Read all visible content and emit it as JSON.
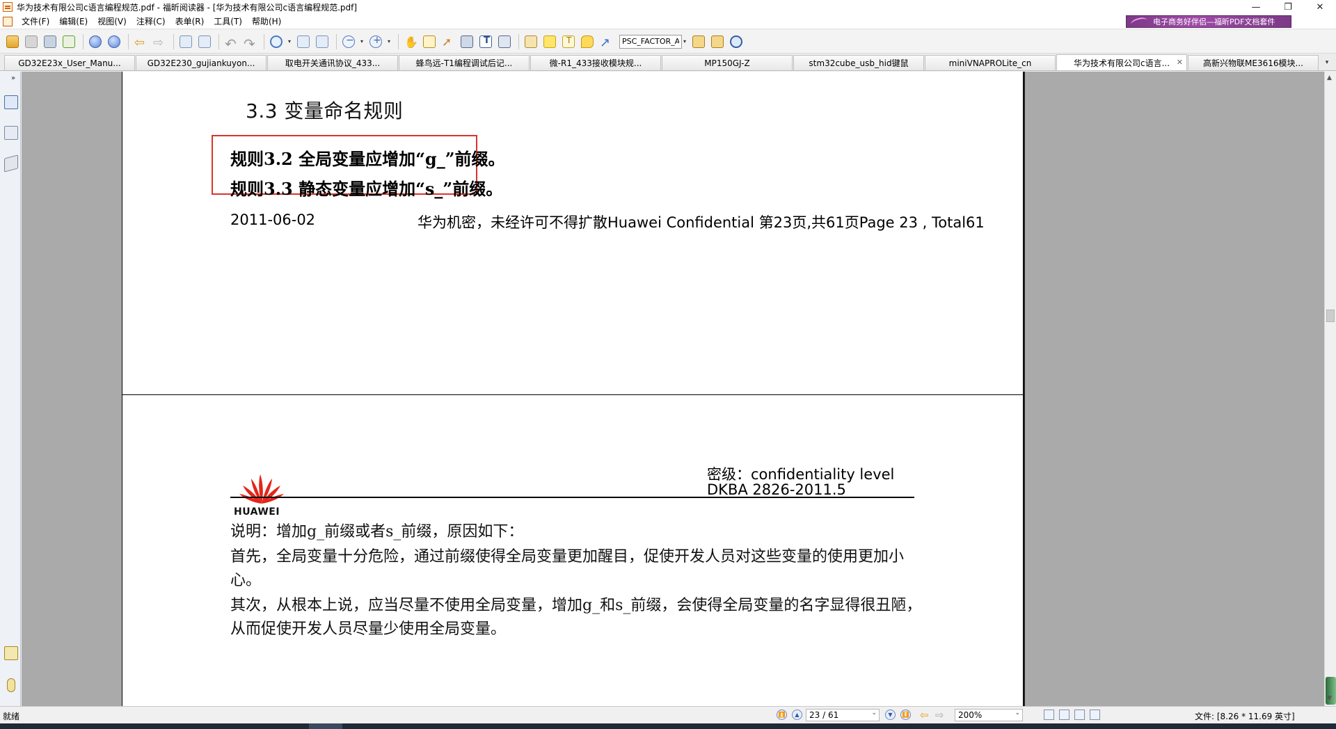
{
  "window": {
    "title": "华为技术有限公司c语言编程规范.pdf - 福昕阅读器 - [华为技术有限公司c语言编程规范.pdf]",
    "min_glyph": "—",
    "restore_glyph": "❐",
    "close_glyph": "✕"
  },
  "menu": {
    "items": [
      "文件(F)",
      "编辑(E)",
      "视图(V)",
      "注释(C)",
      "表单(R)",
      "工具(T)",
      "帮助(H)"
    ],
    "ad_text": "电子商务好伴侣—福昕PDF文档套件"
  },
  "toolbar": {
    "search_value": "PSC_FACTOR_A",
    "dropdown_glyph": "▾"
  },
  "tabs": [
    {
      "label": "GD32E23x_User_Manu..."
    },
    {
      "label": "GD32E230_gujiankuyon..."
    },
    {
      "label": "取电开关通讯协议_433..."
    },
    {
      "label": "蜂鸟远-T1编程调试后记..."
    },
    {
      "label": "微-R1_433接收模块规..."
    },
    {
      "label": "MP150GJ-Z"
    },
    {
      "label": "stm32cube_usb_hid键鼠"
    },
    {
      "label": "miniVNAPROLite_cn"
    },
    {
      "label": "华为技术有限公司c语言...",
      "active": true,
      "close": "✕"
    },
    {
      "label": "高新兴物联ME3616模块..."
    }
  ],
  "tab_menu_glyph": "▾",
  "sidebar": {
    "collapse_glyph": "»"
  },
  "document": {
    "page1": {
      "heading": "3.3  变量命名规则",
      "rule1": "规则3.2  全局变量应增加“g_”前缀。",
      "rule2": "规则3.3  静态变量应增加“s_”前缀。",
      "footer_date": "2011-06-02",
      "footer_conf_zh": "华为机密，未经许可不得扩散",
      "footer_conf_en": "Huawei Confidential  第23页,共61页Page 23 , Total61"
    },
    "page2": {
      "logo_text": "HUAWEI",
      "conf_level": "密级：confidentiality level",
      "doc_number": "DKBA 2826-2011.5",
      "para1": "说明：增加g_前缀或者s_前缀，原因如下：",
      "para2": "首先，全局变量十分危险，通过前缀使得全局变量更加醒目，促使开发人员对这些变量的使用更加小",
      "para3": "心。",
      "para4": "其次，从根本上说，应当尽量不使用全局变量，增加g_和s_前缀，会使得全局变量的名字显得很丑陋，",
      "para5": "从而促使开发人员尽量少使用全局变量。"
    }
  },
  "scrollbar": {
    "up_glyph": "▲",
    "down_glyph": "▼"
  },
  "statusbar": {
    "status": "就绪",
    "page_display": "23 / 61",
    "zoom": "200%",
    "doc_size": "文件: [8.26 * 11.69 英寸]",
    "first_glyph": "⏫",
    "prev_glyph": "▲",
    "next_glyph": "▼",
    "last_glyph": "⏬",
    "back_glyph": "⇦",
    "forward_glyph": "⇨",
    "dd_glyph": "⌄"
  },
  "colors": {
    "highlight_box": "#d9342b",
    "huawei_red": "#e3261b",
    "ad_purple": "#8a3e92"
  }
}
